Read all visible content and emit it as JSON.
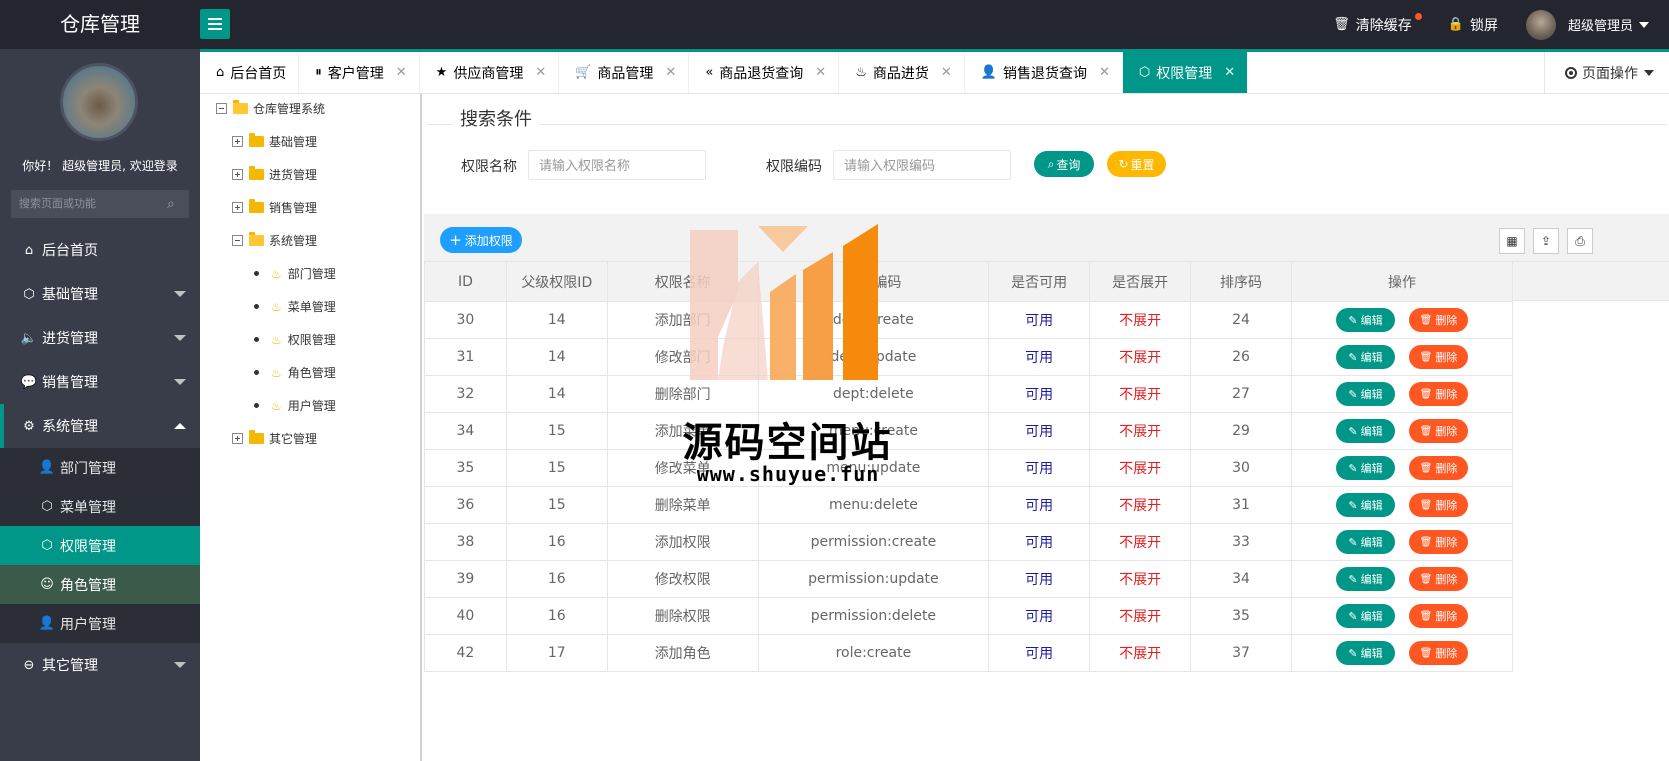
{
  "app": {
    "title": "仓库管理"
  },
  "topbar": {
    "clear_cache": "清除缓存",
    "lock_screen": "锁屏",
    "user_name": "超级管理员"
  },
  "sidebar": {
    "welcome": "你好！ 超级管理员, 欢迎登录",
    "search_placeholder": "搜索页面或功能",
    "items": [
      {
        "label": "后台首页",
        "icon": "home-icon"
      },
      {
        "label": "基础管理",
        "icon": "cube-icon"
      },
      {
        "label": "进货管理",
        "icon": "volume-icon"
      },
      {
        "label": "销售管理",
        "icon": "chat-icon"
      },
      {
        "label": "系统管理",
        "icon": "gear-icon"
      },
      {
        "label": "其它管理",
        "icon": "circle-icon"
      }
    ],
    "sub_items": [
      {
        "label": "部门管理",
        "icon": "user-outline-icon"
      },
      {
        "label": "菜单管理",
        "icon": "cube-icon"
      },
      {
        "label": "权限管理",
        "icon": "cube-icon"
      },
      {
        "label": "角色管理",
        "icon": "smile-icon"
      },
      {
        "label": "用户管理",
        "icon": "user-icon"
      }
    ]
  },
  "tabs": [
    {
      "label": "后台首页",
      "icon": "home-icon",
      "closable": false
    },
    {
      "label": "客户管理",
      "icon": "pause-icon",
      "closable": true
    },
    {
      "label": "供应商管理",
      "icon": "star-icon",
      "closable": true
    },
    {
      "label": "商品管理",
      "icon": "cart-icon",
      "closable": true
    },
    {
      "label": "商品退货查询",
      "icon": "rewind-icon",
      "closable": true
    },
    {
      "label": "商品进货",
      "icon": "fire-icon",
      "closable": true
    },
    {
      "label": "销售退货查询",
      "icon": "user-outline-icon",
      "closable": true
    },
    {
      "label": "权限管理",
      "icon": "cube-icon",
      "closable": true,
      "active": true
    }
  ],
  "page_ops": "页面操作",
  "tree": {
    "root": "仓库管理系统",
    "nodes": [
      {
        "label": "基础管理"
      },
      {
        "label": "进货管理"
      },
      {
        "label": "销售管理"
      },
      {
        "label": "系统管理"
      },
      {
        "label": "其它管理"
      }
    ],
    "leaves": [
      "部门管理",
      "菜单管理",
      "权限管理",
      "角色管理",
      "用户管理"
    ]
  },
  "search": {
    "legend": "搜索条件",
    "name_label": "权限名称",
    "name_placeholder": "请输入权限名称",
    "code_label": "权限编码",
    "code_placeholder": "请输入权限编码",
    "query_btn": "查询",
    "reset_btn": "重置"
  },
  "toolbar": {
    "add_btn": "添加权限"
  },
  "table": {
    "headers": [
      "ID",
      "父级权限ID",
      "权限名称",
      "权限编码",
      "是否可用",
      "是否展开",
      "排序码",
      "操作"
    ],
    "edit_label": "编辑",
    "delete_label": "删除",
    "rows": [
      [
        "30",
        "14",
        "添加部门",
        "dept:create",
        "可用",
        "不展开",
        "24"
      ],
      [
        "31",
        "14",
        "修改部门",
        "dept:update",
        "可用",
        "不展开",
        "26"
      ],
      [
        "32",
        "14",
        "删除部门",
        "dept:delete",
        "可用",
        "不展开",
        "27"
      ],
      [
        "34",
        "15",
        "添加菜单",
        "menu:create",
        "可用",
        "不展开",
        "29"
      ],
      [
        "35",
        "15",
        "修改菜单",
        "menu:update",
        "可用",
        "不展开",
        "30"
      ],
      [
        "36",
        "15",
        "删除菜单",
        "menu:delete",
        "可用",
        "不展开",
        "31"
      ],
      [
        "38",
        "16",
        "添加权限",
        "permission:create",
        "可用",
        "不展开",
        "33"
      ],
      [
        "39",
        "16",
        "修改权限",
        "permission:update",
        "可用",
        "不展开",
        "34"
      ],
      [
        "40",
        "16",
        "删除权限",
        "permission:delete",
        "可用",
        "不展开",
        "35"
      ],
      [
        "42",
        "17",
        "添加角色",
        "role:create",
        "可用",
        "不展开",
        "37"
      ]
    ]
  },
  "watermark": {
    "title": "源码空间站",
    "url": "www.shuyue.fun"
  },
  "colors": {
    "accent": "#009688",
    "header": "#23262e",
    "sidebar": "#393d49",
    "danger": "#ff5722",
    "warn": "#ffb800",
    "info": "#1e9fff"
  }
}
